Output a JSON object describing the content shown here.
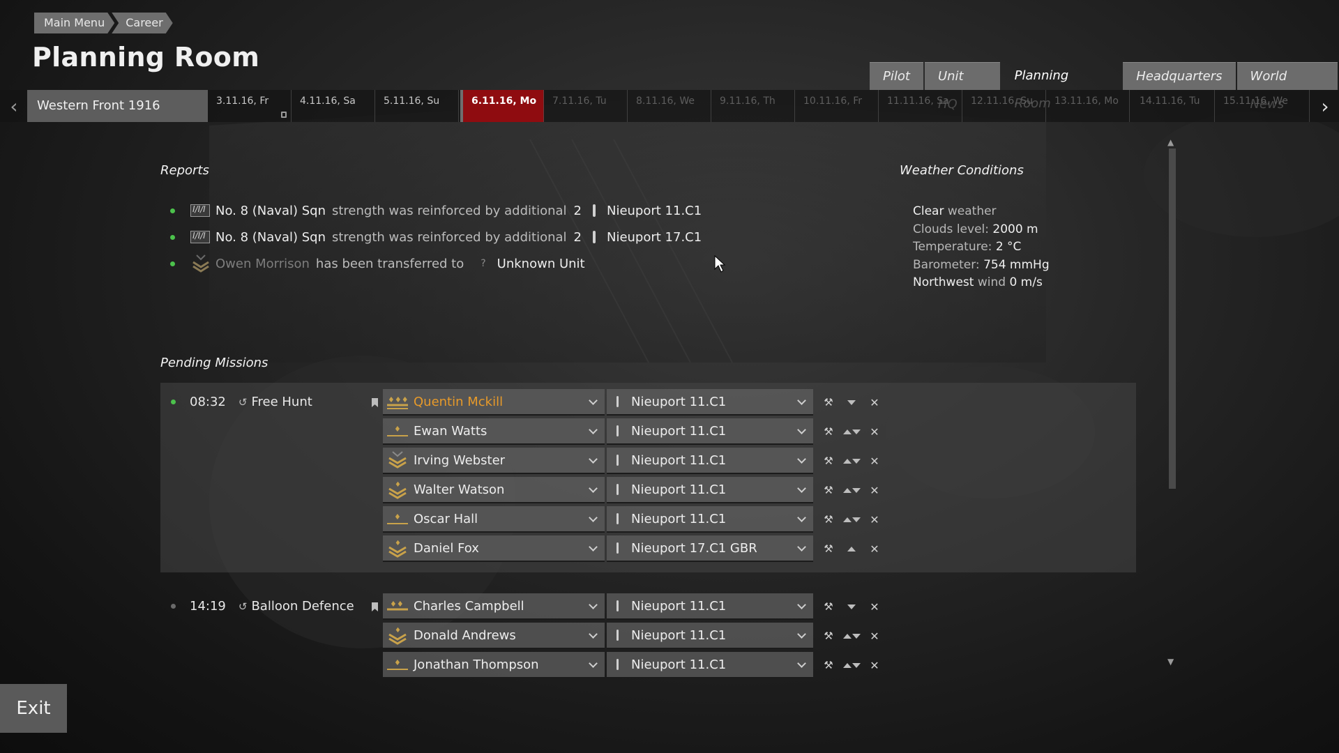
{
  "breadcrumb": [
    "Main Menu",
    "Career"
  ],
  "page_title": "Planning Room",
  "tabs": [
    {
      "label": "Pilot",
      "active": false
    },
    {
      "label": "Unit HQ",
      "active": false
    },
    {
      "label": "Planning Room",
      "active": true
    },
    {
      "label": "Headquarters",
      "active": false
    },
    {
      "label": "World News",
      "active": false
    }
  ],
  "timeline": {
    "campaign": "Western Front 1916",
    "days": [
      {
        "label": "3.11.16, Fr",
        "state": "past"
      },
      {
        "label": "4.11.16, Sa",
        "state": "past"
      },
      {
        "label": "5.11.16, Su",
        "state": "past"
      },
      {
        "label": "6.11.16, Mo",
        "state": "current"
      },
      {
        "label": "7.11.16, Tu",
        "state": "future"
      },
      {
        "label": "8.11.16, We",
        "state": "future"
      },
      {
        "label": "9.11.16, Th",
        "state": "future"
      },
      {
        "label": "10.11.16, Fr",
        "state": "future"
      },
      {
        "label": "11.11.16, Sa",
        "state": "future"
      },
      {
        "label": "12.11.16, Su",
        "state": "future"
      },
      {
        "label": "13.11.16, Mo",
        "state": "future"
      },
      {
        "label": "14.11.16, Tu",
        "state": "future"
      },
      {
        "label": "15.11.16, We",
        "state": "future"
      }
    ]
  },
  "reports": {
    "title": "Reports",
    "items": [
      {
        "unit": "No. 8 (Naval) Sqn",
        "text": "strength was reinforced by additional",
        "count": "2",
        "aircraft": "Nieuport 11.C1"
      },
      {
        "unit": "No. 8 (Naval) Sqn",
        "text": "strength was reinforced by additional",
        "count": "2",
        "aircraft": "Nieuport 17.C1"
      },
      {
        "pilot": "Owen Morrison",
        "text": "has been transferred to",
        "marker": "?",
        "destination": "Unknown Unit"
      }
    ]
  },
  "weather": {
    "title": "Weather Conditions",
    "condition_value": "Clear",
    "condition_label": "weather",
    "clouds_label": "Clouds level:",
    "clouds_value": "2000 m",
    "temp_label": "Temperature:",
    "temp_value": "2 °C",
    "baro_label": "Barometer:",
    "baro_value": "754 mmHg",
    "wind_dir": "Northwest",
    "wind_label": "wind",
    "wind_value": "0 m/s"
  },
  "missions": {
    "title": "Pending Missions",
    "list": [
      {
        "time": "08:32",
        "type": "Free Hunt",
        "status_color": "#4cc24c",
        "flights": [
          {
            "pilot": "Quentin Mckill",
            "aircraft": "Nieuport 11.C1",
            "lead": true,
            "rank": "three-stars"
          },
          {
            "pilot": "Ewan Watts",
            "aircraft": "Nieuport 11.C1",
            "lead": false,
            "rank": "one-star"
          },
          {
            "pilot": "Irving Webster",
            "aircraft": "Nieuport 11.C1",
            "lead": false,
            "rank": "chevrons"
          },
          {
            "pilot": "Walter Watson",
            "aircraft": "Nieuport 11.C1",
            "lead": false,
            "rank": "chevrons-star"
          },
          {
            "pilot": "Oscar Hall",
            "aircraft": "Nieuport 11.C1",
            "lead": false,
            "rank": "one-star"
          },
          {
            "pilot": "Daniel Fox",
            "aircraft": "Nieuport 17.C1 GBR",
            "lead": false,
            "rank": "chevrons-star"
          }
        ]
      },
      {
        "time": "14:19",
        "type": "Balloon Defence",
        "status_color": "#6a6a6a",
        "flights": [
          {
            "pilot": "Charles Campbell",
            "aircraft": "Nieuport 11.C1",
            "lead": true,
            "rank": "two-stars"
          },
          {
            "pilot": "Donald Andrews",
            "aircraft": "Nieuport 11.C1",
            "lead": false,
            "rank": "chevrons-star"
          },
          {
            "pilot": "Jonathan Thompson",
            "aircraft": "Nieuport 11.C1",
            "lead": false,
            "rank": "one-star"
          }
        ]
      }
    ]
  },
  "exit_label": "Exit",
  "colors": {
    "accent_red": "#8f0c10",
    "lead_orange": "#e79a2a",
    "status_green": "#4cc24c"
  }
}
